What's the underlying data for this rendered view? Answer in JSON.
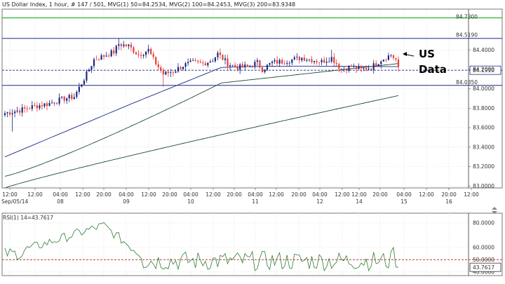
{
  "header": {
    "symbol": "US Dollar Index",
    "info": ", 1 hour, # 147 / 501, ",
    "mvg1_label": "MVG(1) 50=84.2534",
    "sep1": ", ",
    "mvg2_label": "MVG(2) 100=84.2453",
    "sep2": ", ",
    "mvg3_label": "MVG(3) 200=83.9348"
  },
  "annotation": {
    "line1": "US",
    "line2": "Data"
  },
  "rsi": {
    "label": "RSI(1) 14=43.7617",
    "ticks": [
      "80.0000",
      "60.0000",
      "50.0000",
      "40.0000"
    ],
    "tick_values": [
      80,
      60,
      50,
      40
    ],
    "ylim": [
      37,
      88
    ],
    "last_value": "43.7617",
    "level": 50
  },
  "chart_data": {
    "type": "candlestick",
    "ylim": [
      82.98,
      84.82
    ],
    "y_ticks": [
      "84.4000",
      "84.2000",
      "84.0000",
      "83.8000",
      "83.6000",
      "83.4000",
      "83.2000",
      "83.0000"
    ],
    "y_tick_values": [
      84.4,
      84.2,
      84.0,
      83.8,
      83.6,
      83.4,
      83.2,
      83.0
    ],
    "x_ticks": [
      {
        "time": "12:00",
        "date": "Sep/05/14"
      },
      {
        "time": "12:00",
        "date": ""
      },
      {
        "time": "04:00",
        "date": "08"
      },
      {
        "time": "12:00",
        "date": ""
      },
      {
        "time": "20:00",
        "date": ""
      },
      {
        "time": "04:00",
        "date": "09"
      },
      {
        "time": "12:00",
        "date": ""
      },
      {
        "time": "20:00",
        "date": ""
      },
      {
        "time": "04:00",
        "date": "10"
      },
      {
        "time": "12:00",
        "date": ""
      },
      {
        "time": "20:00",
        "date": ""
      },
      {
        "time": "04:00",
        "date": "11"
      },
      {
        "time": "12:00",
        "date": ""
      },
      {
        "time": "20:00",
        "date": ""
      },
      {
        "time": "04:00",
        "date": "12"
      },
      {
        "time": "12:00",
        "date": ""
      },
      {
        "time": "12:00",
        "date": "14"
      },
      {
        "time": "20:00",
        "date": ""
      },
      {
        "time": "04:00",
        "date": "15"
      },
      {
        "time": "12:00",
        "date": ""
      },
      {
        "time": "20:00",
        "date": ""
      },
      {
        "time": "04:00",
        "date": "16"
      },
      {
        "time": "12:00",
        "date": ""
      }
    ],
    "levels": [
      {
        "value": 84.519,
        "label": "84.5190",
        "color": "#1a2a8a",
        "style": "solid"
      },
      {
        "value": 84.035,
        "label": "84.0350",
        "color": "#1a2a8a",
        "style": "solid"
      },
      {
        "value": 84.191,
        "label": "84.1910",
        "color": "#1a2a8a",
        "style": "dashed",
        "boxed": true
      },
      {
        "value": 84.73,
        "label": "84.7300",
        "color": "#00aa00",
        "style": "solid"
      }
    ],
    "colors": {
      "up": "#1a237e",
      "down": "#e53935",
      "ma50": "#1b4d2e",
      "ma100": "#1b4d2e",
      "ma200": "#1a2a8a",
      "rsi": "#2e7d32",
      "rsi_level": "#b71c1c"
    },
    "candles": [],
    "ma50": [],
    "ma100": [],
    "ma200": [],
    "rsi_values": []
  }
}
